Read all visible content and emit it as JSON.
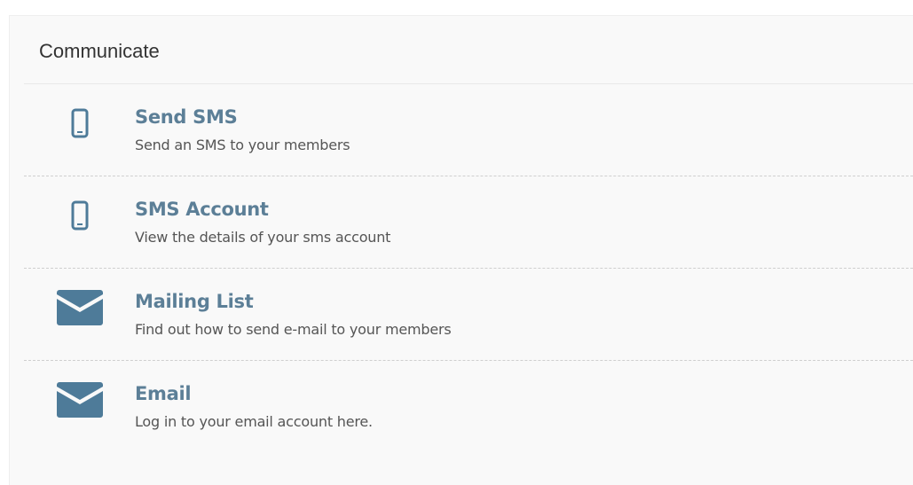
{
  "panel": {
    "title": "Communicate",
    "items": [
      {
        "title": "Send SMS",
        "description": "Send an SMS to your members",
        "icon": "mobile-phone-icon"
      },
      {
        "title": "SMS Account",
        "description": "View the details of your sms account",
        "icon": "mobile-phone-icon"
      },
      {
        "title": "Mailing List",
        "description": "Find out how to send e-mail to your members",
        "icon": "envelope-icon"
      },
      {
        "title": "Email",
        "description": "Log in to your email account here.",
        "icon": "envelope-icon"
      }
    ]
  },
  "colors": {
    "icon": "#4e7b99",
    "link_title": "#5c7f97"
  }
}
